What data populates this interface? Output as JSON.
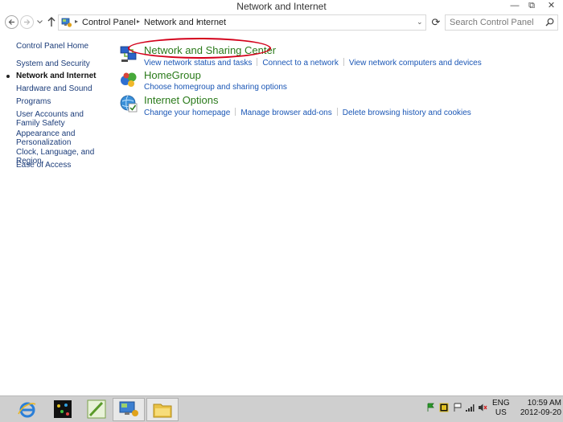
{
  "window": {
    "title": "Network and Internet",
    "minimize_glyph": "—",
    "maximize_glyph": "⧉",
    "close_glyph": "✕"
  },
  "address_bar": {
    "breadcrumbs": [
      "Control Panel",
      "Network and Internet"
    ],
    "separator": "▸",
    "dropdown_glyph": "⌄",
    "refresh_glyph": "⟳"
  },
  "search": {
    "placeholder": "Search Control Panel"
  },
  "sidebar": {
    "items": [
      {
        "label": "Control Panel Home"
      },
      {
        "label": "System and Security"
      },
      {
        "label": "Network and Internet",
        "current": true
      },
      {
        "label": "Hardware and Sound"
      },
      {
        "label": "Programs"
      },
      {
        "label": "User Accounts and Family Safety"
      },
      {
        "label": "Appearance and Personalization"
      },
      {
        "label": "Clock, Language, and Region"
      },
      {
        "label": "Ease of Access"
      }
    ]
  },
  "categories": [
    {
      "title": "Network and Sharing Center",
      "icon": "network-icon",
      "links": [
        "View network status and tasks",
        "Connect to a network",
        "View network computers and devices"
      ]
    },
    {
      "title": "HomeGroup",
      "icon": "homegroup-icon",
      "links": [
        "Choose homegroup and sharing options"
      ]
    },
    {
      "title": "Internet Options",
      "icon": "internet-options-icon",
      "links": [
        "Change your homepage",
        "Manage browser add-ons",
        "Delete browsing history and cookies"
      ]
    }
  ],
  "taskbar": {
    "apps": [
      "internet-explorer-icon",
      "command-prompt-icon",
      "notepad-icon",
      "control-panel-icon",
      "file-explorer-icon"
    ],
    "language": {
      "line1": "ENG",
      "line2": "US"
    },
    "clock": {
      "time": "10:59 AM",
      "date": "2012-09-20"
    }
  },
  "colors": {
    "category_title": "#2a7a1a",
    "link": "#1a56b5",
    "highlight_ellipse": "#d3001a",
    "taskbar": "#cfcfcf"
  }
}
